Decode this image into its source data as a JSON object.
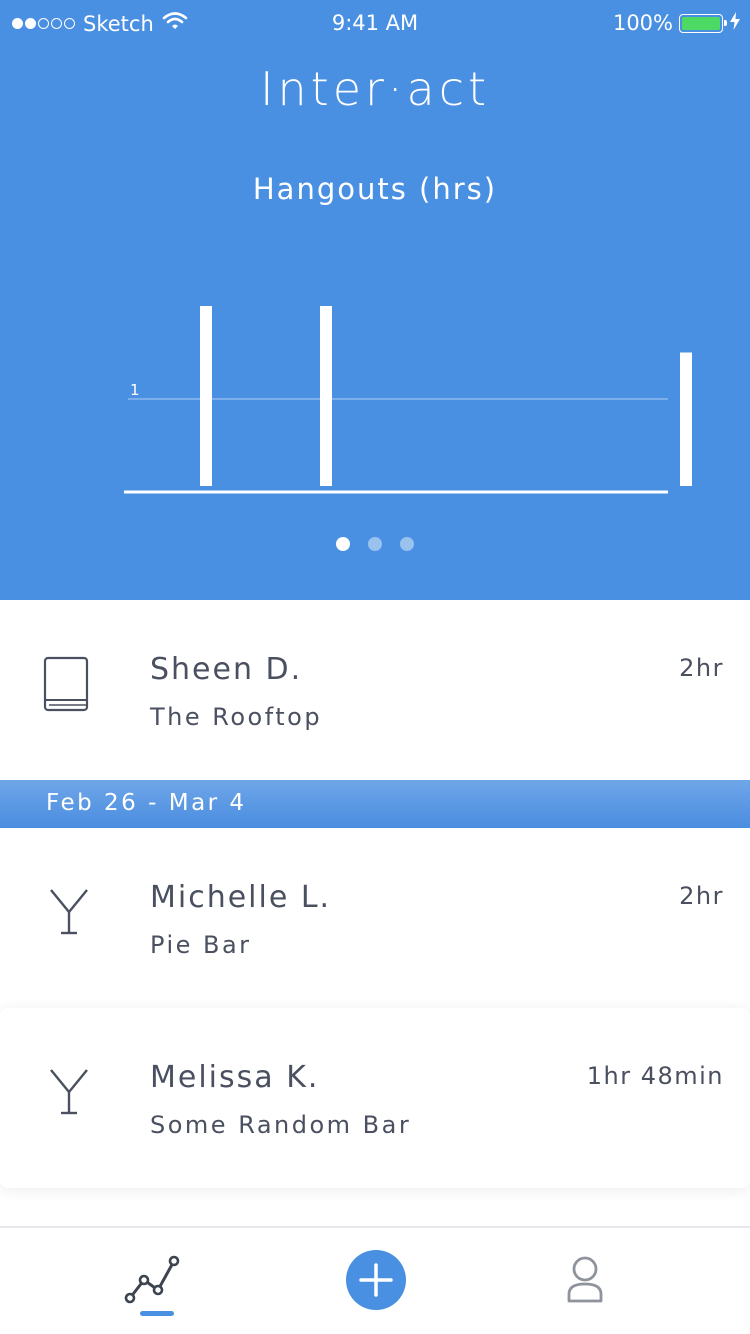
{
  "status_bar": {
    "carrier": "Sketch",
    "time": "9:41 AM",
    "battery": "100%",
    "signal_bars_filled": 2,
    "signal_bars_total": 5,
    "battery_color": "#4cd964"
  },
  "header": {
    "app_title": "Inter·act",
    "background_color": "#4a90e2"
  },
  "chart_data": {
    "type": "bar",
    "title": "Hangouts (hrs)",
    "categories": [
      "",
      "",
      "",
      "",
      ""
    ],
    "values": [
      2,
      2,
      0,
      0,
      1.5
    ],
    "y_tick_labels": [
      "1"
    ],
    "y_ticks": [
      1
    ],
    "ylim": [
      0,
      2
    ],
    "grid": true,
    "bar_color": "#ffffff"
  },
  "pager": {
    "pages": 3,
    "active_index": 0
  },
  "list": [
    {
      "name": "Sheen D.",
      "place": "The Rooftop",
      "duration": "2hr",
      "icon": "book-icon"
    },
    {
      "name": "Michelle L.",
      "place": "Pie Bar",
      "duration": "2hr",
      "icon": "cocktail-icon"
    },
    {
      "name": "Melissa K.",
      "place": "Some Random Bar",
      "duration": "1hr 48min",
      "icon": "cocktail-icon"
    }
  ],
  "section": {
    "date_range": "Feb 26 - Mar 4"
  },
  "tab_bar": {
    "tabs": [
      "chart-line-icon",
      "plus-circle-icon",
      "user-icon"
    ],
    "active_index": 0,
    "accent_color": "#4a90e2"
  }
}
